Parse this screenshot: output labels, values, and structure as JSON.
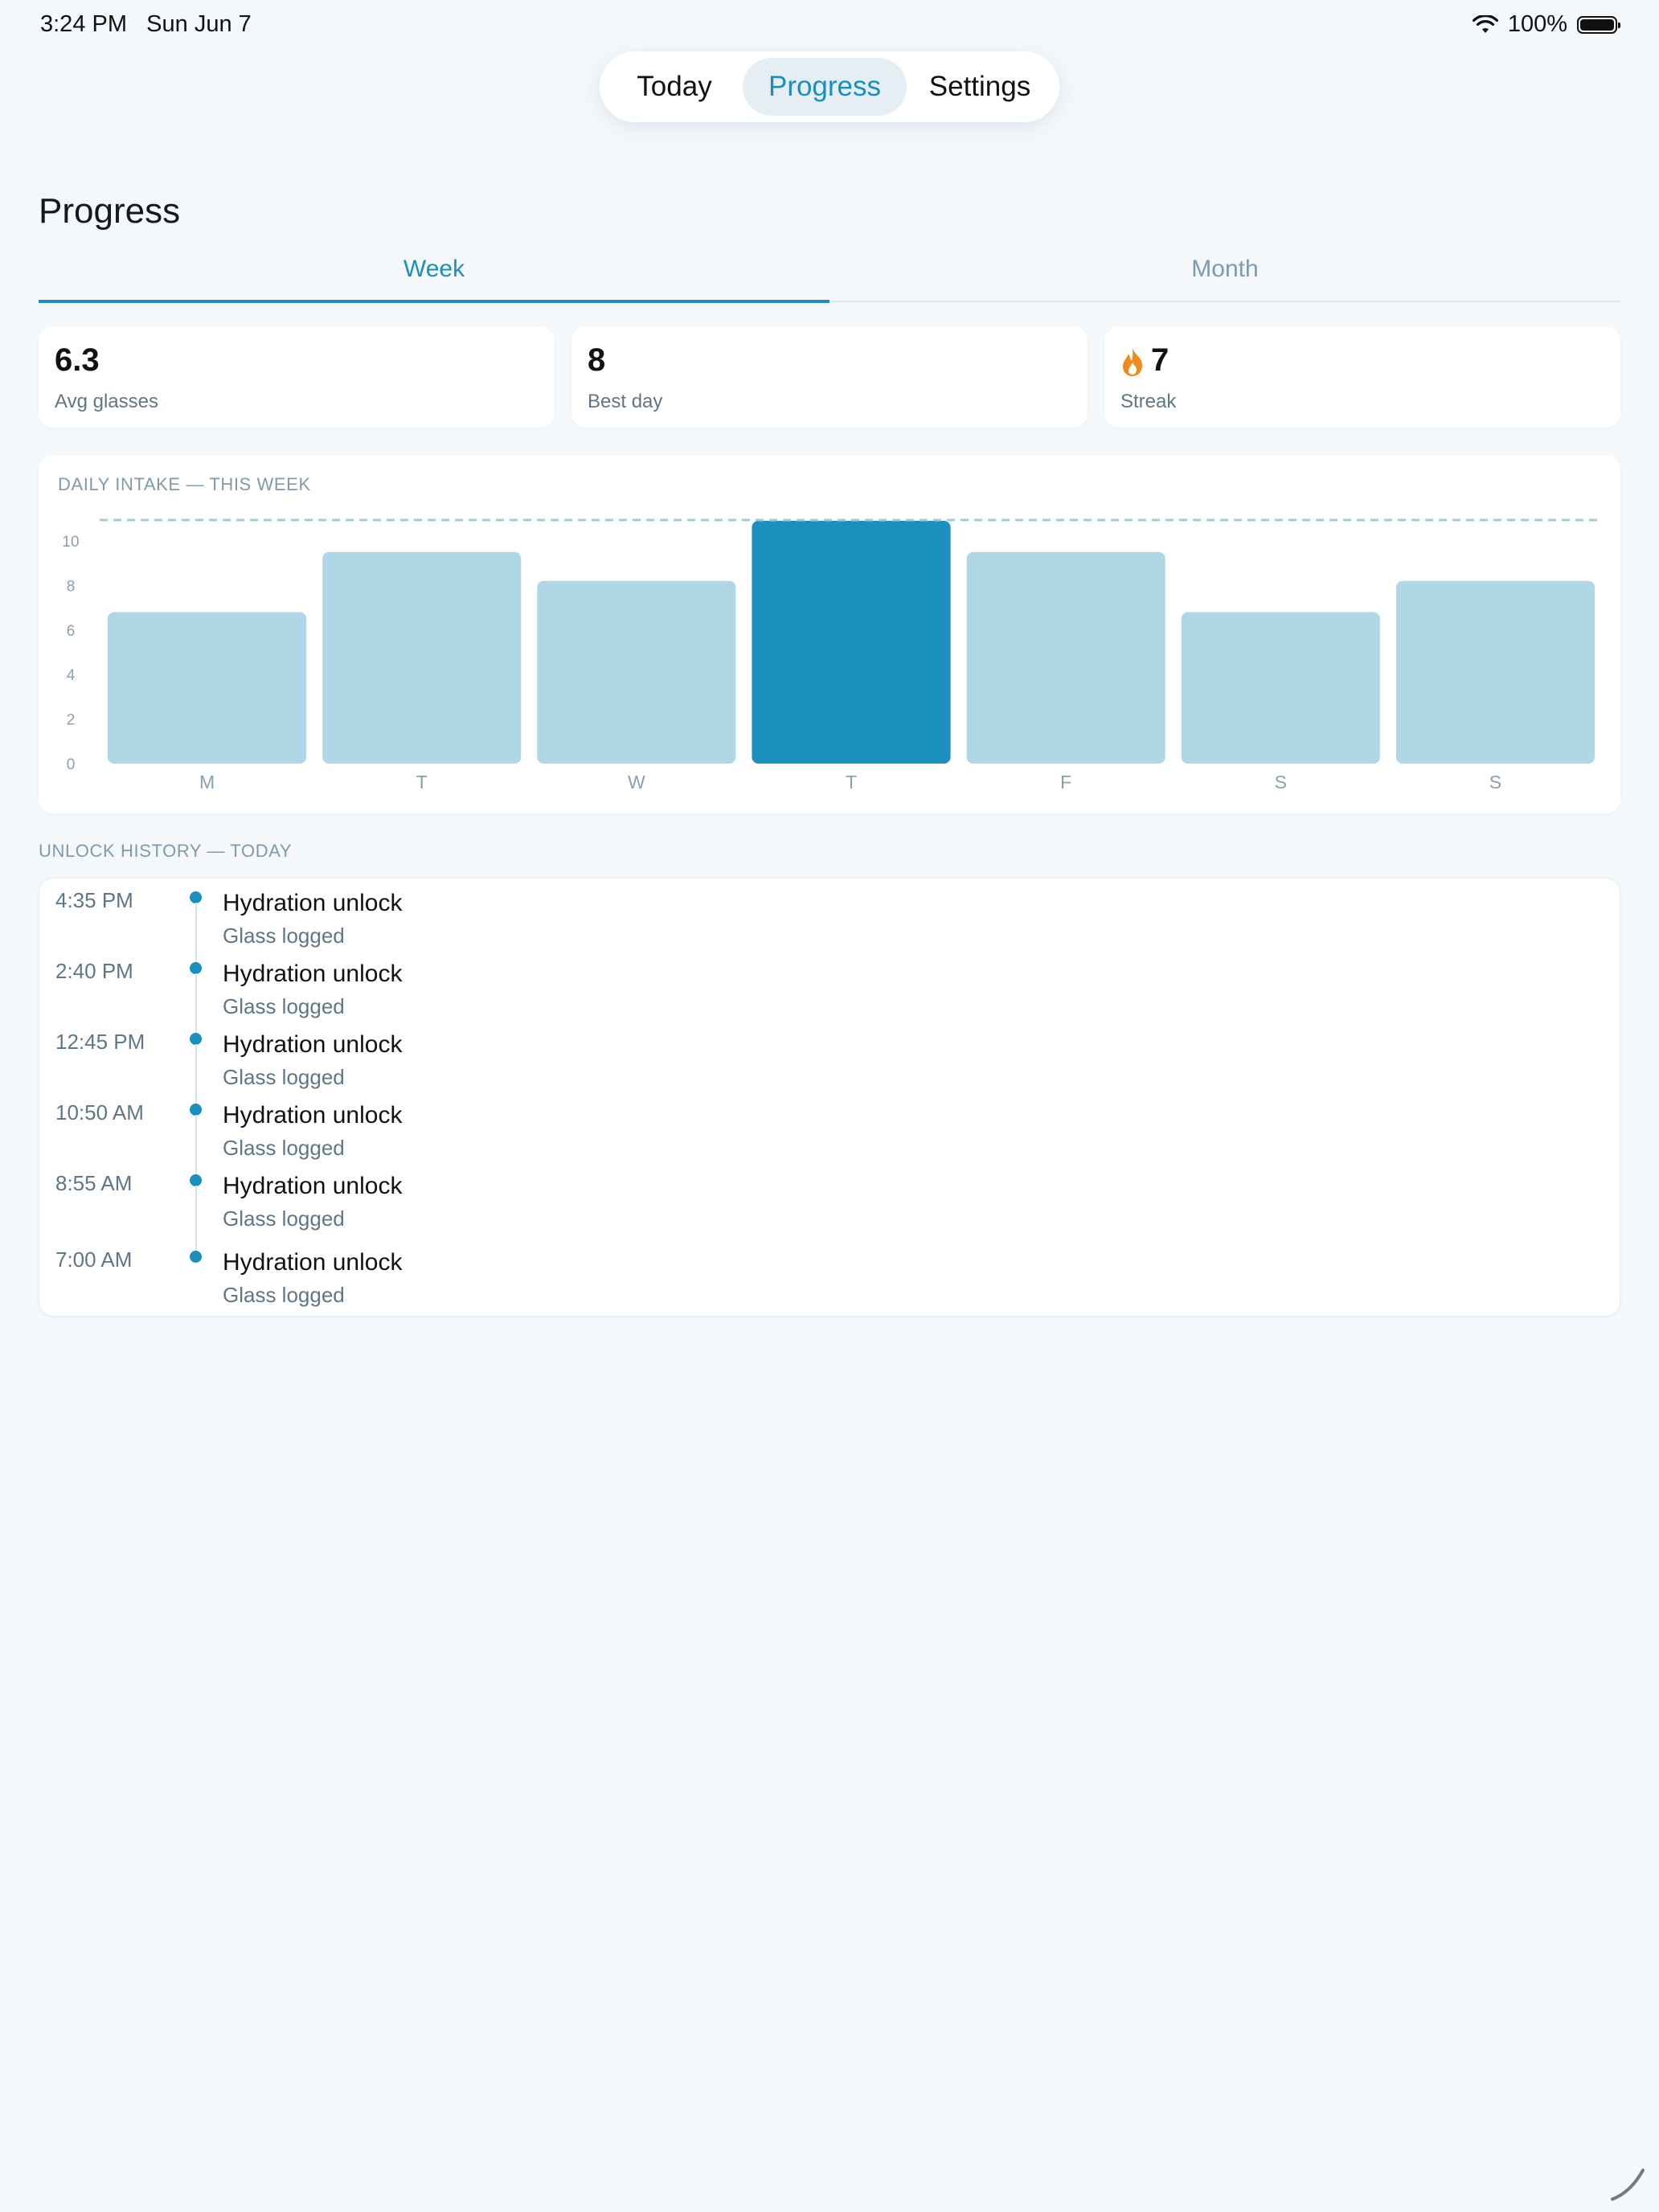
{
  "status_bar": {
    "time": "3:24 PM",
    "date": "Sun Jun 7",
    "battery": "100%",
    "icons": [
      "wifi-icon",
      "battery-icon"
    ]
  },
  "nav": {
    "items": [
      {
        "label": "Today",
        "active": false
      },
      {
        "label": "Progress",
        "active": true
      },
      {
        "label": "Settings",
        "active": false
      }
    ]
  },
  "page": {
    "title": "Progress"
  },
  "tabs": [
    {
      "label": "Week",
      "active": true
    },
    {
      "label": "Month",
      "active": false
    }
  ],
  "stats": [
    {
      "value": "6.3",
      "label": "Avg glasses",
      "icon": ""
    },
    {
      "value": "8",
      "label": "Best day",
      "icon": ""
    },
    {
      "value": "7",
      "label": "Streak",
      "icon": "flame-icon"
    }
  ],
  "chart_data": {
    "type": "bar",
    "title": "DAILY INTAKE — THIS WEEK",
    "categories": [
      "M",
      "T",
      "W",
      "T",
      "F",
      "S",
      "S"
    ],
    "values": [
      6.8,
      9.5,
      8.2,
      10.9,
      9.5,
      6.8,
      8.2
    ],
    "highlight_index": 3,
    "goal": 10.9,
    "ylim": [
      0,
      10.9
    ],
    "yticks": [
      "0",
      "2",
      "4",
      "6",
      "8",
      "10"
    ],
    "colors": {
      "bar": "#afd8e6",
      "highlight": "#1b8fbe",
      "goal_line": "#a9c9d8",
      "tick": "#8aa0ad"
    }
  },
  "history": {
    "title": "UNLOCK HISTORY — TODAY",
    "items": [
      {
        "time": "4:35 PM",
        "title": "Hydration unlock",
        "subtitle": "Glass logged"
      },
      {
        "time": "2:40 PM",
        "title": "Hydration unlock",
        "subtitle": "Glass logged"
      },
      {
        "time": "12:45 PM",
        "title": "Hydration unlock",
        "subtitle": "Glass logged"
      },
      {
        "time": "10:50 AM",
        "title": "Hydration unlock",
        "subtitle": "Glass logged"
      },
      {
        "time": "8:55 AM",
        "title": "Hydration unlock",
        "subtitle": "Glass logged"
      },
      {
        "time": "7:00 AM",
        "title": "Hydration unlock",
        "subtitle": "Glass logged"
      }
    ]
  },
  "colors": {
    "accent": "#1a8fbd",
    "background": "#f4f8fb",
    "flame": "#f08a1c"
  }
}
